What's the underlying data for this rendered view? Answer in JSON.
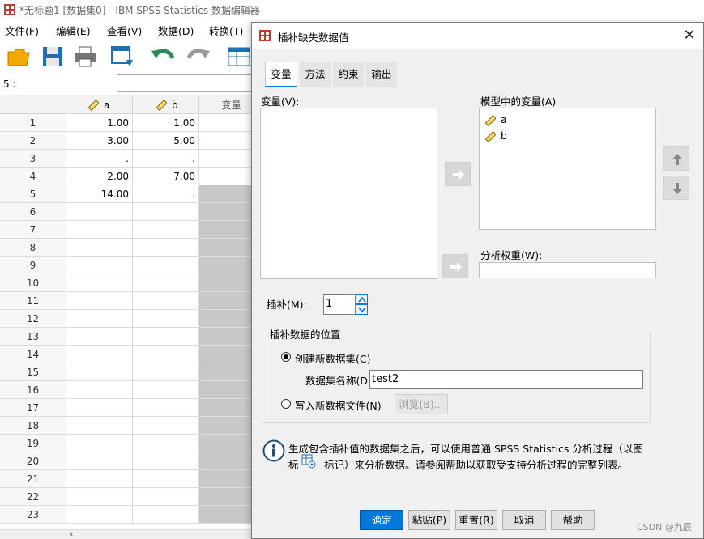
{
  "app": {
    "title": "*无标题1 [数据集0] - IBM SPSS Statistics 数据编辑器",
    "menu": [
      "文件(F)",
      "编辑(E)",
      "查看(V)",
      "数据(D)",
      "转换(T)"
    ],
    "cell_ref": "5 :"
  },
  "grid": {
    "columns": [
      "a",
      "b",
      "变量"
    ],
    "rows": [
      {
        "n": "1",
        "a": "1.00",
        "b": "1.00"
      },
      {
        "n": "2",
        "a": "3.00",
        "b": "5.00"
      },
      {
        "n": "3",
        "a": ".",
        "b": "."
      },
      {
        "n": "4",
        "a": "2.00",
        "b": "7.00"
      },
      {
        "n": "5",
        "a": "14.00",
        "b": "."
      },
      {
        "n": "6",
        "a": "",
        "b": ""
      },
      {
        "n": "7",
        "a": "",
        "b": ""
      },
      {
        "n": "8",
        "a": "",
        "b": ""
      },
      {
        "n": "9",
        "a": "",
        "b": ""
      },
      {
        "n": "10",
        "a": "",
        "b": ""
      },
      {
        "n": "11",
        "a": "",
        "b": ""
      },
      {
        "n": "12",
        "a": "",
        "b": ""
      },
      {
        "n": "13",
        "a": "",
        "b": ""
      },
      {
        "n": "14",
        "a": "",
        "b": ""
      },
      {
        "n": "15",
        "a": "",
        "b": ""
      },
      {
        "n": "16",
        "a": "",
        "b": ""
      },
      {
        "n": "17",
        "a": "",
        "b": ""
      },
      {
        "n": "18",
        "a": "",
        "b": ""
      },
      {
        "n": "19",
        "a": "",
        "b": ""
      },
      {
        "n": "20",
        "a": "",
        "b": ""
      },
      {
        "n": "21",
        "a": "",
        "b": ""
      },
      {
        "n": "22",
        "a": "",
        "b": ""
      },
      {
        "n": "23",
        "a": "",
        "b": ""
      }
    ]
  },
  "dialog": {
    "title": "插补缺失数据值",
    "tabs": [
      "变量",
      "方法",
      "约束",
      "输出"
    ],
    "variables_label": "变量(V):",
    "model_vars_label": "模型中的变量(A)",
    "model_vars": [
      "a",
      "b"
    ],
    "weight_label": "分析权重(W):",
    "imputations_label": "插补(M):",
    "imputations_value": "1",
    "location_group_label": "插补数据的位置",
    "create_dataset_label": "创建新数据集(C)",
    "dataset_name_label": "数据集名称(D",
    "dataset_name_value": "test2",
    "write_file_label": "写入新数据文件(N)",
    "browse_label": "浏览(B)...",
    "info_line1": "生成包含插补值的数据集之后，可以使用普通 SPSS Statistics 分析过程（以图",
    "info_line2_a": "标",
    "info_line2_b": "标记）来分析数据。请参阅帮助以获取受支持分析过程的完整列表。",
    "buttons": {
      "ok": "确定",
      "paste": "粘贴(P)",
      "reset": "重置(R)",
      "cancel": "取消",
      "help": "帮助"
    }
  },
  "watermark": "CSDN @九辰",
  "colors": {
    "accent": "#0078d7",
    "title_icon": "#c0392b",
    "arrow_green": "#2e8b57",
    "folder": "#f2a900"
  }
}
